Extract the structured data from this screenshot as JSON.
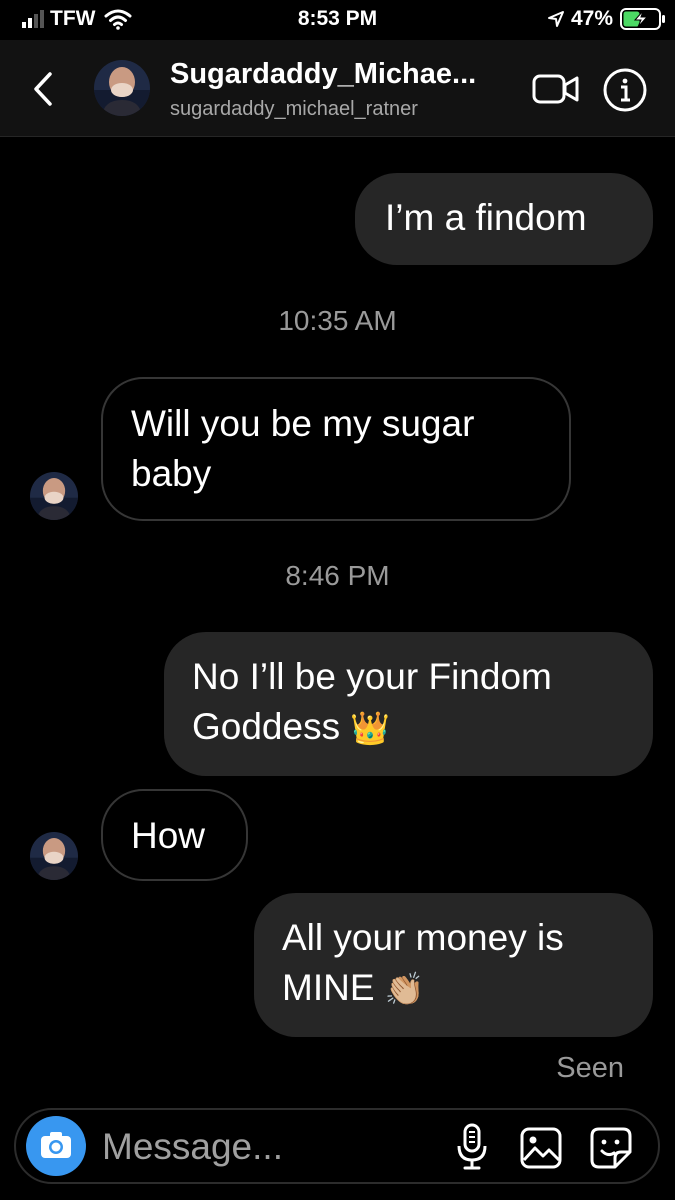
{
  "status_bar": {
    "carrier": "TFW",
    "time": "8:53 PM",
    "battery_percent": "47%",
    "battery_level": 0.47,
    "icons": [
      "signal-icon",
      "wifi-icon",
      "location-arrow-icon",
      "battery-charging-icon"
    ]
  },
  "header": {
    "display_name": "Sugardaddy_Michae...",
    "username": "sugardaddy_michael_ratner",
    "icons": [
      "back-chevron-icon",
      "avatar",
      "video-call-icon",
      "info-icon"
    ]
  },
  "messages": [
    {
      "direction": "out",
      "text": "I’m a findom"
    },
    {
      "type": "timestamp",
      "text": "10:35 AM"
    },
    {
      "direction": "in",
      "line1": "Will you be my sugar",
      "line2": "baby"
    },
    {
      "type": "timestamp",
      "text": "8:46 PM"
    },
    {
      "direction": "out",
      "line1": "No I’ll be your Findom",
      "line2": "Goddess",
      "emoji": "👑"
    },
    {
      "direction": "in",
      "text": "How"
    },
    {
      "direction": "out",
      "line1": "All your money is",
      "line2": "MINE",
      "emoji": "👏🏼"
    }
  ],
  "seen_label": "Seen",
  "composer": {
    "placeholder": "Message...",
    "icons": [
      "camera-icon",
      "microphone-icon",
      "gallery-icon",
      "sticker-icon"
    ]
  },
  "colors": {
    "background": "#000000",
    "header_bg": "#121212",
    "outgoing_bubble": "#262626",
    "incoming_border": "#363636",
    "camera_button": "#3897f0",
    "secondary_text": "#a8a8a8"
  }
}
